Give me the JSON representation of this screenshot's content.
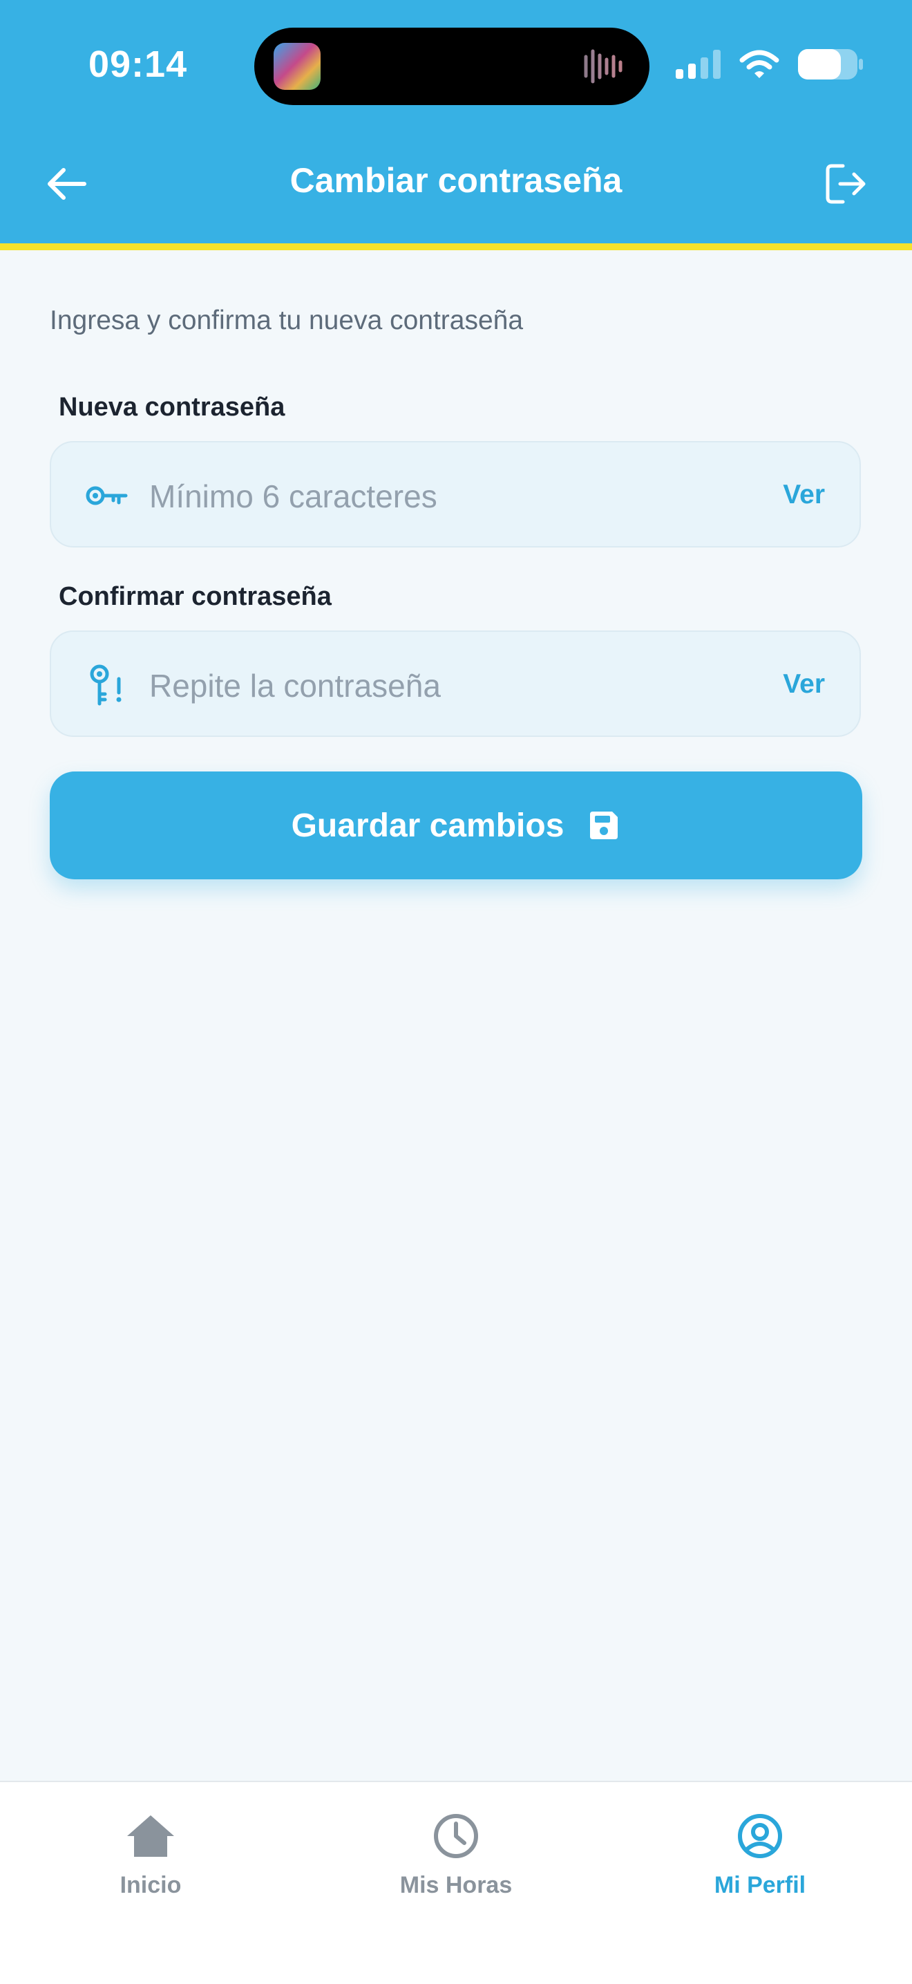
{
  "status_bar": {
    "time": "09:14"
  },
  "header": {
    "title": "Cambiar contraseña"
  },
  "form": {
    "instructions": "Ingresa y confirma tu nueva contraseña",
    "new_password": {
      "label": "Nueva contraseña",
      "placeholder": "Mínimo 6 caracteres",
      "value": "",
      "toggle_label": "Ver",
      "icon": "key-icon"
    },
    "confirm_password": {
      "label": "Confirmar contraseña",
      "placeholder": "Repite la contraseña",
      "value": "",
      "toggle_label": "Ver",
      "icon": "key-alert-icon"
    },
    "save_button": {
      "label": "Guardar cambios",
      "icon": "floppy-disk-icon"
    }
  },
  "tab_bar": {
    "items": [
      {
        "label": "Inicio",
        "icon": "home-icon",
        "active": false
      },
      {
        "label": "Mis Horas",
        "icon": "clock-icon",
        "active": false
      },
      {
        "label": "Mi Perfil",
        "icon": "user-circle-icon",
        "active": true
      }
    ]
  },
  "colors": {
    "primary": "#37b1e4",
    "accent_stripe": "#f5e22b",
    "background": "#f3f8fb",
    "inactive": "#8a939c"
  }
}
